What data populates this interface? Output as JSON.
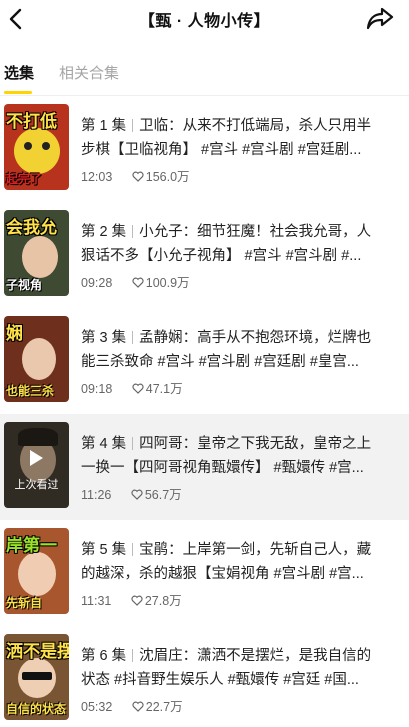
{
  "header": {
    "title": "【甄 · 人物小传】",
    "back_icon": "back-arrow-icon",
    "share_icon": "share-icon"
  },
  "tabs": [
    {
      "label": "选集",
      "active": true
    },
    {
      "label": "相关合集",
      "active": false
    }
  ],
  "episodes": [
    {
      "number": "第 1 集",
      "line1": "卫临：从来不打低端局，杀人只用半",
      "line2": "步棋【卫临视角】 #宫斗 #宫斗剧 #宫廷剧...",
      "duration": "12:03",
      "likes": "156.0万",
      "thumb_top": "不打低",
      "thumb_bottom": "起完了",
      "thumb_color": "#b8331e",
      "last_watched": false
    },
    {
      "number": "第 2 集",
      "line1": "小允子：细节狂魔！社会我允哥，人",
      "line2": "狠话不多【小允子视角】 #宫斗 #宫斗剧 #...",
      "duration": "09:28",
      "likes": "100.9万",
      "thumb_top": "会我允",
      "thumb_bottom": "子视角",
      "thumb_color": "#3f4a33",
      "last_watched": false
    },
    {
      "number": "第 3 集",
      "line1": "孟静娴：高手从不抱怨环境，烂牌也",
      "line2": "能三杀致命 #宫斗 #宫斗剧 #宫廷剧 #皇宫...",
      "duration": "09:18",
      "likes": "47.1万",
      "thumb_top": "娴",
      "thumb_bottom": "也能三杀",
      "thumb_color": "#6e2f1c",
      "last_watched": false
    },
    {
      "number": "第 4 集",
      "line1": "四阿哥：皇帝之下我无敌，皇帝之上",
      "line2": "一换一【四阿哥视角甄嬛传】 #甄嬛传 #宫...",
      "duration": "11:26",
      "likes": "56.7万",
      "thumb_top": "",
      "thumb_bottom": "",
      "thumb_color": "#4a4438",
      "last_watched": true,
      "last_watched_label": "上次看过"
    },
    {
      "number": "第 5 集",
      "line1": "宝鹃：上岸第一剑，先斩自己人，藏",
      "line2": "的越深，杀的越狠【宝娟视角 #宫斗剧 #宫...",
      "duration": "11:31",
      "likes": "27.8万",
      "thumb_top": "岸第一",
      "thumb_bottom": "先斩自",
      "thumb_color": "#a7562e",
      "last_watched": false
    },
    {
      "number": "第 6 集",
      "line1": "沈眉庄：潇洒不是摆烂，是我自信的",
      "line2": "状态 #抖音野生娱乐人 #甄嬛传 #宫廷 #国...",
      "duration": "05:32",
      "likes": "22.7万",
      "thumb_top": "洒不是摆",
      "thumb_bottom": "自信的状态",
      "thumb_color": "#7a5533",
      "last_watched": false
    }
  ],
  "colors": {
    "accent": "#ffd400",
    "inactive_tab": "#a5a5a5",
    "watched_bg": "#f2f2f2"
  }
}
